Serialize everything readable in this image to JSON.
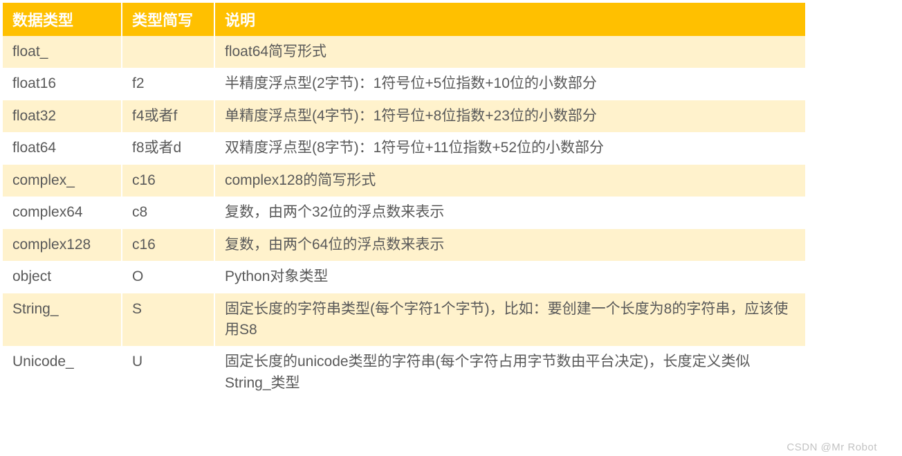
{
  "table": {
    "headers": {
      "col1": "数据类型",
      "col2": "类型简写",
      "col3": "说明"
    },
    "rows": [
      {
        "type": "float_",
        "abbr": "",
        "desc": "float64简写形式"
      },
      {
        "type": "float16",
        "abbr": "f2",
        "desc": "半精度浮点型(2字节)：1符号位+5位指数+10位的小数部分"
      },
      {
        "type": "float32",
        "abbr": "f4或者f",
        "desc": "单精度浮点型(4字节)：1符号位+8位指数+23位的小数部分"
      },
      {
        "type": "float64",
        "abbr": "f8或者d",
        "desc": "双精度浮点型(8字节)：1符号位+11位指数+52位的小数部分"
      },
      {
        "type": "complex_",
        "abbr": "c16",
        "desc": "complex128的简写形式"
      },
      {
        "type": "complex64",
        "abbr": "c8",
        "desc": "复数，由两个32位的浮点数来表示"
      },
      {
        "type": "complex128",
        "abbr": "c16",
        "desc": "复数，由两个64位的浮点数来表示"
      },
      {
        "type": "object",
        "abbr": "O",
        "desc": "Python对象类型"
      },
      {
        "type": "String_",
        "abbr": "S",
        "desc": "固定长度的字符串类型(每个字符1个字节)，比如：要创建一个长度为8的字符串，应该使用S8"
      },
      {
        "type": "Unicode_",
        "abbr": "U",
        "desc": "固定长度的unicode类型的字符串(每个字符占用字节数由平台决定)，长度定义类似String_类型"
      }
    ]
  },
  "watermark": "CSDN @Mr  Robot"
}
